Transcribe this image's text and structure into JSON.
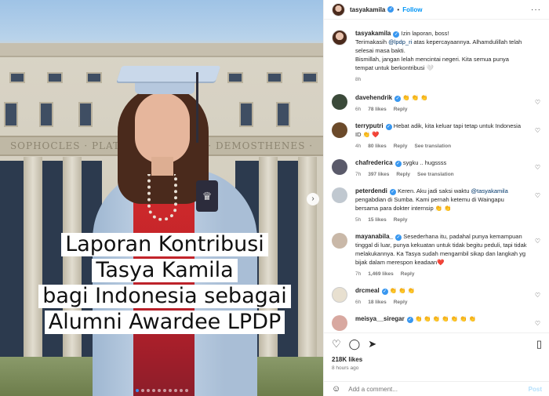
{
  "post": {
    "image_title_lines": [
      "Laporan Kontribusi",
      "Tasya Kamila",
      "bagi Indonesia sebagai",
      "Alumni Awardee LPDP"
    ],
    "frieze_text": "SOPHOCLES · PLATO · ARISTOTLE · DEMOSTHENES · CICERO",
    "carousel_total": 10,
    "carousel_active": 1
  },
  "header": {
    "username": "tasyakamila",
    "separator": "•",
    "follow_label": "Follow",
    "more_label": "···"
  },
  "caption": {
    "username": "tasyakamila",
    "line1": "Izin laporan, boss!",
    "line2_pre": "Terimakasih ",
    "line2_mention": "@lpdp_ri",
    "line2_post": " atas kepercayaannya. Alhamdulillah telah selesai masa bakti.",
    "line3": "Bismillah, jangan lelah mencintai negeri. Kita semua punya tempat untuk berkontribusi 🤍",
    "time": "8h"
  },
  "comments": [
    {
      "username": "davehendrik",
      "text": "👏 👏 👏",
      "time": "6h",
      "likes": "78 likes",
      "reply": "Reply",
      "extra": "",
      "avatar_color": "#3b4a3a"
    },
    {
      "username": "terryputri",
      "text": "Hebat adik, kita keluar tapi tetap untuk Indonesia ID 👏 ❤️",
      "time": "4h",
      "likes": "80 likes",
      "reply": "Reply",
      "extra": "See translation",
      "avatar_color": "#6b4a2a"
    },
    {
      "username": "chafrederica",
      "text": "sygku .. hugssss",
      "time": "7h",
      "likes": "397 likes",
      "reply": "Reply",
      "extra": "See translation",
      "avatar_color": "#5a5a6a"
    },
    {
      "username": "peterdendi",
      "text_pre": "Keren. Aku jadi saksi waktu ",
      "mention": "@tasyakamila",
      "text_post": " pengabdian di Sumba. Kami pernah ketemu di Waingapu bersama para dokter internsip 👏 👏",
      "time": "5h",
      "likes": "15 likes",
      "reply": "Reply",
      "extra": "",
      "avatar_color": "#c0c8d0"
    },
    {
      "username": "mayanabila_",
      "text": "Sesederhana itu, padahal punya kemampuan tinggal di luar, punya kekuatan untuk tidak begitu peduli, tapi tidak melakukannya. Ka Tasya sudah mengambil sikap dan langkah yg bijak dalam merespon keadaan❤️",
      "time": "7h",
      "likes": "1,469 likes",
      "reply": "Reply",
      "extra": "",
      "avatar_color": "#c9b8a8"
    },
    {
      "username": "drcmeal",
      "text": "👏 👏 👏",
      "time": "6h",
      "likes": "18 likes",
      "reply": "Reply",
      "extra": "",
      "avatar_color": "#e8e0d0"
    },
    {
      "username": "meisya__siregar",
      "text": "👏 👏 👏 👏 👏 👏 👏",
      "time": "",
      "likes": "",
      "reply": "",
      "extra": "",
      "avatar_color": "#d8a8a0"
    }
  ],
  "footer": {
    "likes": "218K likes",
    "ago": "8 hours ago",
    "comment_placeholder": "Add a comment...",
    "post_label": "Post"
  },
  "icons": {
    "heart": "heart-icon",
    "comment": "comment-icon",
    "share": "share-icon",
    "bookmark": "bookmark-icon",
    "emoji": "emoji-icon",
    "next": "chevron-right-icon"
  }
}
